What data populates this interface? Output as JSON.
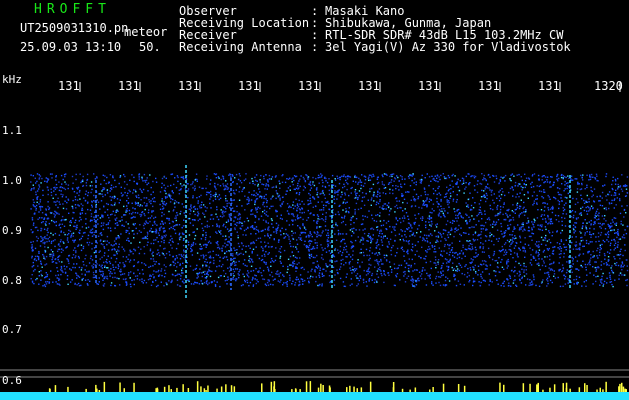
{
  "app": {
    "name": "HROFFT",
    "filename": "UT2509031310.pn",
    "mode": "meteor",
    "datetime": "25.09.03 13:10",
    "count": "50."
  },
  "info": [
    {
      "label": "Observer",
      "value": "Masaki Kano"
    },
    {
      "label": "Receiving Location",
      "value": "Shibukawa, Gunma, Japan"
    },
    {
      "label": "Receiver",
      "value": "RTL-SDR SDR# 43dB L15 103.2MHz CW"
    },
    {
      "label": "Receiving Antenna",
      "value": "3el Yagi(V) Az 330 for Vladivostok"
    }
  ],
  "colon": ":",
  "axis": {
    "y_unit": "kHz",
    "x_ticks": [
      "131",
      "131",
      "131",
      "131",
      "131",
      "131",
      "131",
      "131",
      "131",
      "1320"
    ],
    "y_ticks": [
      "1.1",
      "1.0",
      "0.9",
      "0.8",
      "0.7",
      "0.6"
    ]
  },
  "colors": {
    "title_green": "#18e818",
    "noise_blue": "#1a4dff",
    "noise_cyan": "#3fd8ff",
    "signal_yellow": "#ffff40",
    "baseline_cyan": "#22e0ff"
  }
}
